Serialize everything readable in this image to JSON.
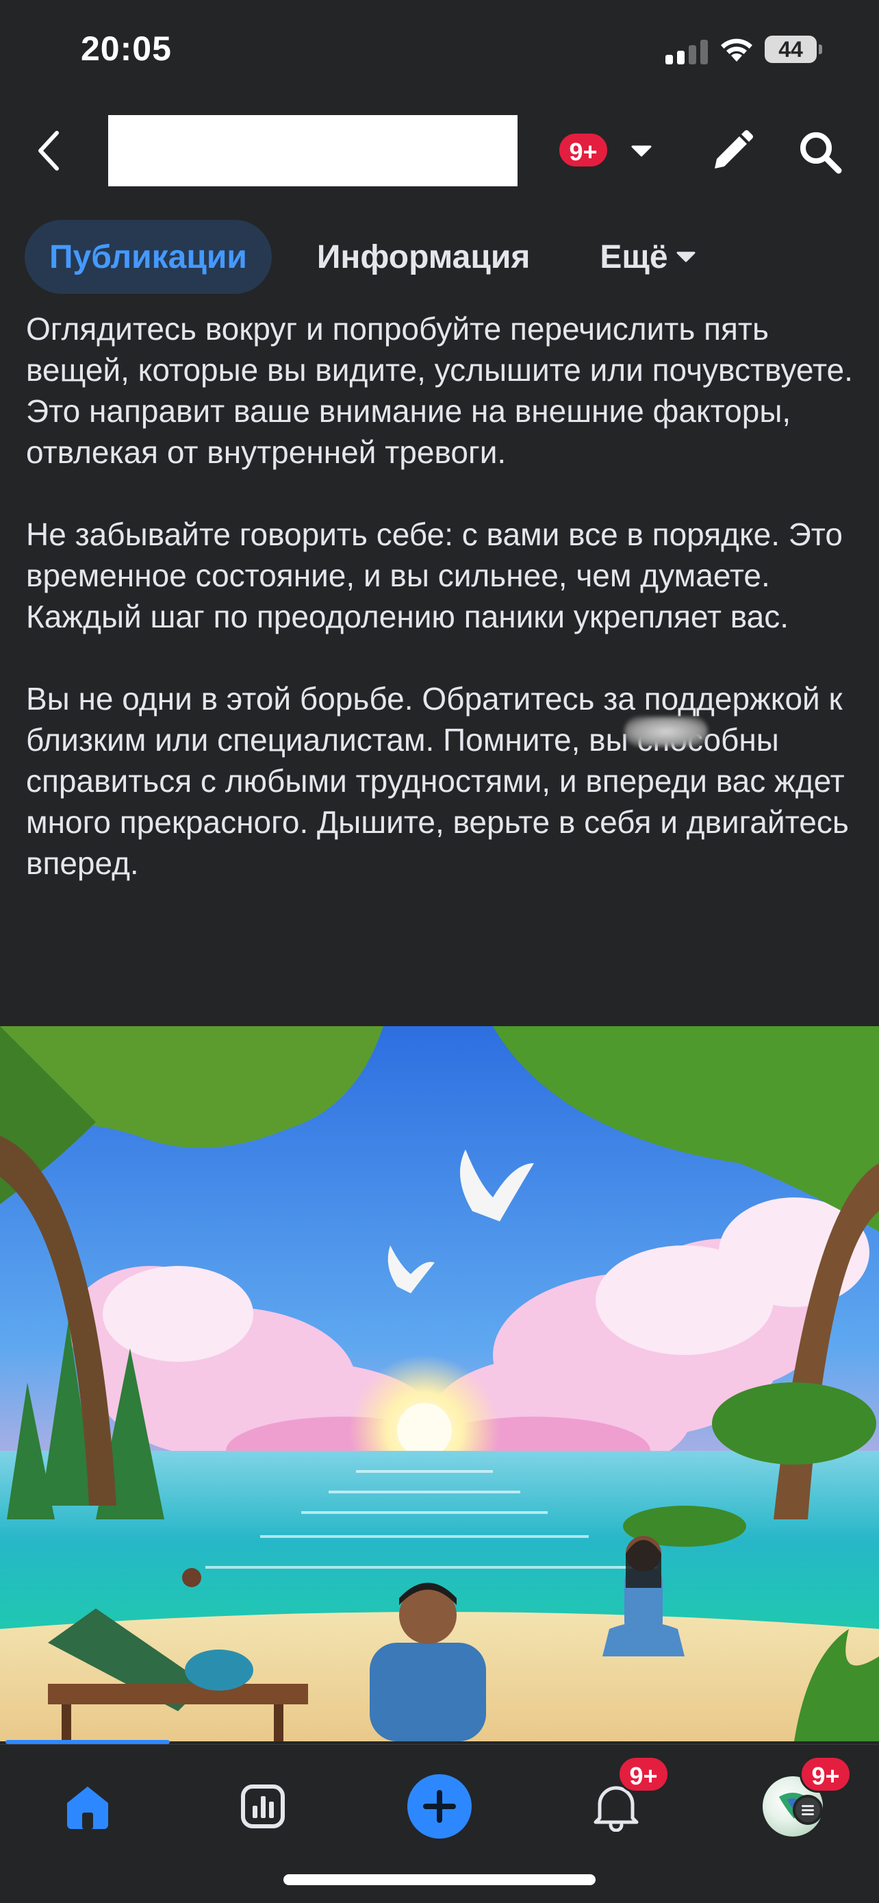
{
  "status_bar": {
    "time": "20:05",
    "battery": "44"
  },
  "header": {
    "badge": "9+",
    "back_icon": "chevron-left-icon",
    "edit_icon": "pencil-icon",
    "search_icon": "search-icon"
  },
  "tabs": [
    {
      "label": "Публикации",
      "active": true
    },
    {
      "label": "Информация",
      "active": false
    },
    {
      "label": "Ещё",
      "active": false
    }
  ],
  "post": {
    "paragraphs": [
      "Оглядитесь вокруг и попробуйте перечислить пять вещей, которые вы видите, услышите или почувствуете. Это направит ваше внимание на внешние факторы, отвлекая от внутренней тревоги.",
      "Не забывайте говорить себе: с вами все в порядке. Это временное состояние, и вы сильнее, чем думаете. Каждый шаг по преодолению паники укрепляет вас.",
      "Вы не одни в этой борьбе. Обратитесь за поддержкой к близким или специалистам. Помните, вы способны справиться с любыми трудностями, и впереди вас ждет много прекрасного. Дышите, верьте в себя и двигайтесь вперед."
    ]
  },
  "tab_bar": {
    "items": [
      {
        "name": "home",
        "icon": "home-icon",
        "active": true
      },
      {
        "name": "dashboard",
        "icon": "dashboard-icon"
      },
      {
        "name": "create",
        "icon": "plus-icon"
      },
      {
        "name": "notifications",
        "icon": "bell-icon",
        "badge": "9+"
      },
      {
        "name": "profile",
        "icon": "avatar",
        "badge": "9+"
      }
    ]
  },
  "colors": {
    "background": "#242527",
    "accent": "#2d88ff",
    "active_tab_bg": "#263951",
    "badge": "#e41e3f"
  }
}
